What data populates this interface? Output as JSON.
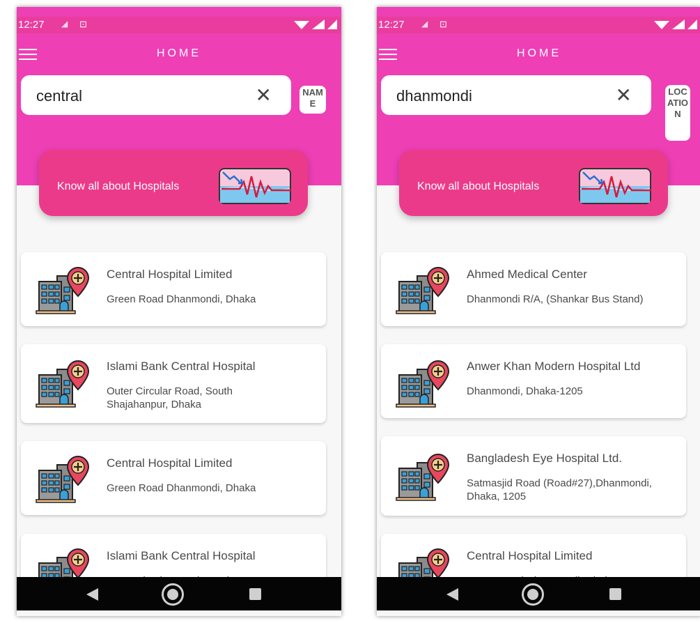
{
  "left": {
    "status": {
      "time": "12:27"
    },
    "title": "HOME",
    "search": {
      "value": "central"
    },
    "filter_label": "NAME",
    "banner_text": "Know all about Hospitals",
    "hospitals": [
      {
        "name": "Central Hospital Limited",
        "address": "Green Road Dhanmondi, Dhaka"
      },
      {
        "name": "Islami Bank Central Hospital",
        "address": "Outer Circular Road, South Shajahanpur, Dhaka"
      },
      {
        "name": "Central Hospital Limited",
        "address": "Green Road Dhanmondi, Dhaka"
      },
      {
        "name": "Islami Bank Central Hospital",
        "address": "Outer Circular Road, South"
      }
    ]
  },
  "right": {
    "status": {
      "time": "12:27"
    },
    "title": "HOME",
    "search": {
      "value": "dhanmondi"
    },
    "filter_label": "LOCATION",
    "banner_text": "Know all about Hospitals",
    "hospitals": [
      {
        "name": "Ahmed Medical Center",
        "address": "Dhanmondi R/A, (Shankar Bus Stand)"
      },
      {
        "name": "Anwer Khan Modern Hospital Ltd",
        "address": "Dhanmondi, Dhaka-1205"
      },
      {
        "name": "Bangladesh Eye Hospital Ltd.",
        "address": "Satmasjid Road (Road#27),Dhanmondi,  Dhaka, 1205"
      },
      {
        "name": "Central Hospital Limited",
        "address": "Green Road Dhanmondi, Dhaka"
      }
    ]
  },
  "colors": {
    "header_pink": "#ee3fb5",
    "banner_pink": "#ec3a8a",
    "nav_bar": "#050505"
  },
  "icons": [
    "menu-icon",
    "close-icon",
    "hospital-location-icon",
    "heartbeat-chart-icon",
    "back-icon",
    "home-icon",
    "recents-icon"
  ]
}
